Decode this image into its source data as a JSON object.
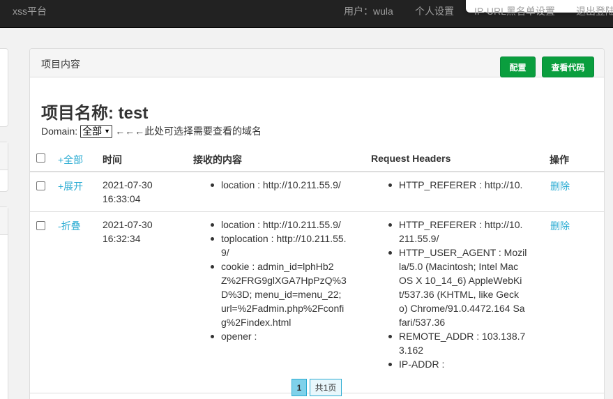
{
  "navbar": {
    "brand": "xss平台",
    "user": "用户：wula",
    "settings": "个人设置",
    "blocklist": "IP-URL黑名单设置",
    "logout": "退出登陆"
  },
  "panel": {
    "heading": "项目内容",
    "config_label": "配置",
    "view_code_label": "查看代码",
    "project_title": "项目名称: test",
    "domain_label": "Domain:",
    "domain_selected": "全部",
    "domain_hint": "←←←此处可选择需要查看的域名"
  },
  "table": {
    "headers": {
      "all": "+全部",
      "time": "时间",
      "content": "接收的内容",
      "request_headers": "Request Headers",
      "action": "操作"
    },
    "rows": [
      {
        "toggle": "+展开",
        "time_date": "2021-07-30",
        "time_clock": "16:33:04",
        "content": [
          "location : http://10.211.55.9/"
        ],
        "headers": [
          "HTTP_REFERER : http://10."
        ],
        "action": "删除"
      },
      {
        "toggle": "-折叠",
        "time_date": "2021-07-30",
        "time_clock": "16:32:34",
        "content": [
          "location : http://10.211.55.9/",
          "toplocation : http://10.211.55.9/",
          "cookie : admin_id=lphHb2Z%2FRG9glXGA7HpPzQ%3D%3D; menu_id=menu_22; url=%2Fadmin.php%2Fconfig%2Findex.html",
          "opener :"
        ],
        "headers": [
          "HTTP_REFERER : http://10.211.55.9/",
          "HTTP_USER_AGENT : Mozilla/5.0 (Macintosh; Intel Mac OS X 10_14_6) AppleWebKit/537.36 (KHTML, like Gecko) Chrome/91.0.4472.164 Safari/537.36",
          "REMOTE_ADDR : 103.138.73.162",
          "IP-ADDR :"
        ],
        "action": "删除"
      }
    ]
  },
  "pagination": {
    "current": "1",
    "total": "共1页"
  },
  "colors": {
    "navbar_bg": "#222222",
    "button_green": "#0a9e3e",
    "link_blue": "#2aabd2"
  }
}
